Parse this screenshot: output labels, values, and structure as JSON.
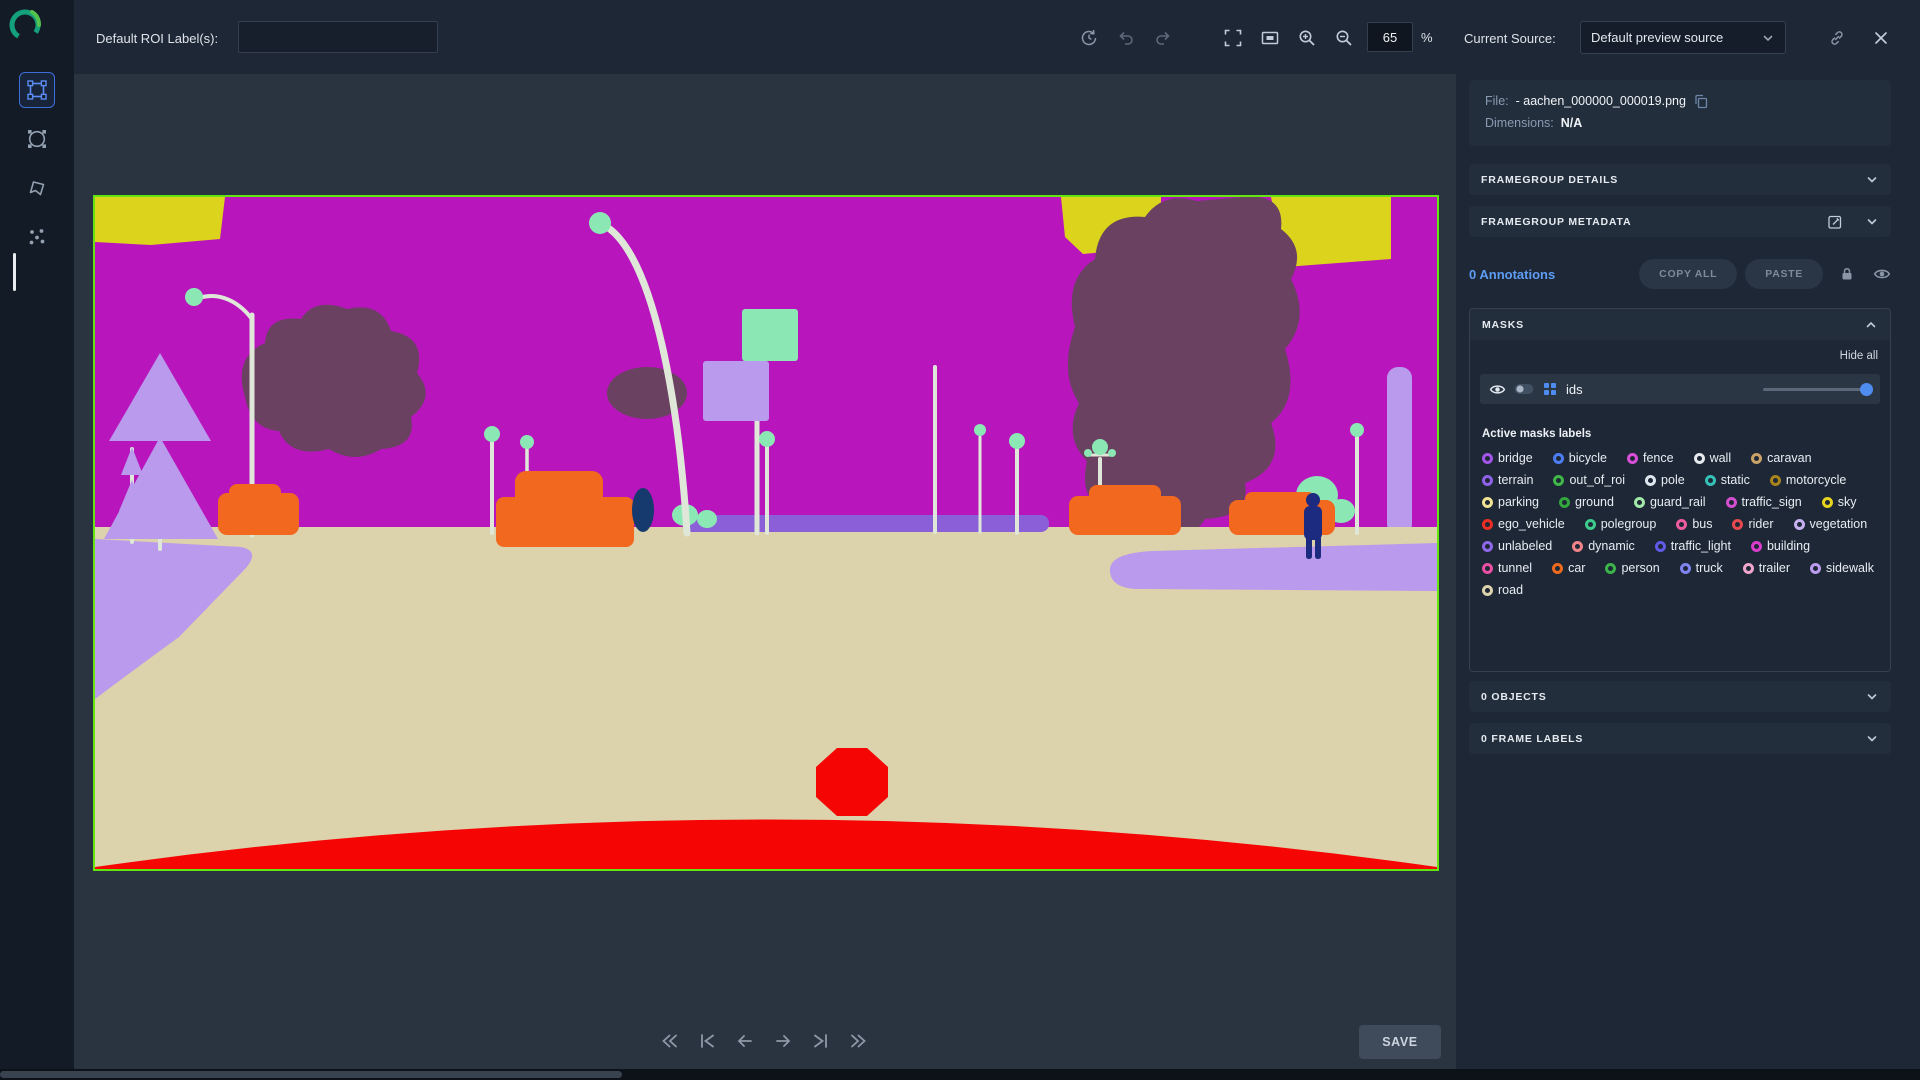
{
  "topbar": {
    "roi_label": "Default ROI Label(s):",
    "roi_value": "",
    "zoom_value": "65",
    "zoom_unit": "%",
    "source_label": "Current Source:",
    "source_value": "Default preview source"
  },
  "file_card": {
    "file_label": "File:",
    "file_name": "- aachen_000000_000019.png",
    "dim_label": "Dimensions:",
    "dim_value": "N/A"
  },
  "sections": {
    "framegroup_details": "FRAMEGROUP DETAILS",
    "framegroup_metadata": "FRAMEGROUP METADATA",
    "objects": "0 OBJECTS",
    "frame_labels": "0 FRAME LABELS"
  },
  "annotations": {
    "count": "0 Annotations",
    "copy_all": "COPY ALL",
    "paste": "PASTE"
  },
  "masks": {
    "title": "MASKS",
    "hide_all": "Hide all",
    "row_label": "ids",
    "active_title": "Active masks labels",
    "labels": [
      {
        "name": "bridge",
        "color": "#a256e8"
      },
      {
        "name": "bicycle",
        "color": "#4d7df2"
      },
      {
        "name": "fence",
        "color": "#d94fd9"
      },
      {
        "name": "wall",
        "color": "#e6e9ee"
      },
      {
        "name": "caravan",
        "color": "#c8a266"
      },
      {
        "name": "terrain",
        "color": "#8f62e8"
      },
      {
        "name": "out_of_roi",
        "color": "#41b649"
      },
      {
        "name": "pole",
        "color": "#dfe6f0"
      },
      {
        "name": "static",
        "color": "#35c0b8"
      },
      {
        "name": "motorcycle",
        "color": "#a8841c"
      },
      {
        "name": "parking",
        "color": "#efe292"
      },
      {
        "name": "ground",
        "color": "#33a63e"
      },
      {
        "name": "guard_rail",
        "color": "#a2e8a8"
      },
      {
        "name": "traffic_sign",
        "color": "#d44fd0"
      },
      {
        "name": "sky",
        "color": "#e6d41f"
      },
      {
        "name": "ego_vehicle",
        "color": "#ee2e24"
      },
      {
        "name": "polegroup",
        "color": "#3dcb8e"
      },
      {
        "name": "bus",
        "color": "#ee5c9e"
      },
      {
        "name": "rider",
        "color": "#e84850"
      },
      {
        "name": "vegetation",
        "color": "#c6b0f0"
      },
      {
        "name": "unlabeled",
        "color": "#8f68ea"
      },
      {
        "name": "dynamic",
        "color": "#f08488"
      },
      {
        "name": "traffic_light",
        "color": "#5f5ae8"
      },
      {
        "name": "building",
        "color": "#d93ccc"
      },
      {
        "name": "tunnel",
        "color": "#e850a4"
      },
      {
        "name": "car",
        "color": "#f06a1e"
      },
      {
        "name": "person",
        "color": "#3cb44a"
      },
      {
        "name": "truck",
        "color": "#8084f0"
      },
      {
        "name": "trailer",
        "color": "#f0a6cc"
      },
      {
        "name": "sidewalk",
        "color": "#bb9cee"
      },
      {
        "name": "road",
        "color": "#dcd2ac"
      }
    ]
  },
  "save_label": "SAVE"
}
